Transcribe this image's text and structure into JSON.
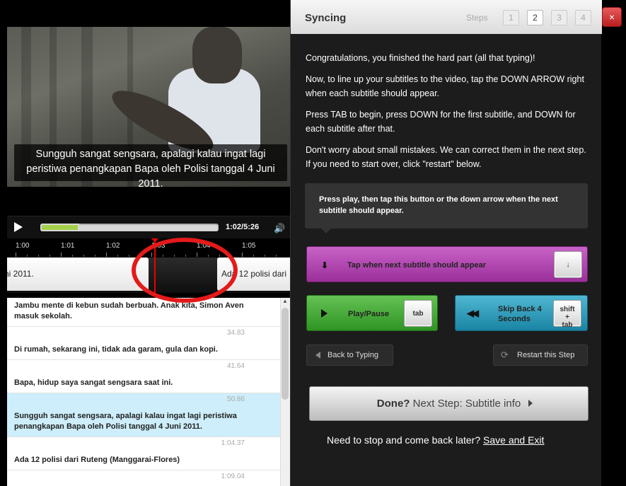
{
  "video": {
    "subtitle": "Sungguh sangat sengsara, apalagi kalau ingat lagi peristiwa penangkapan Bapa oleh Polisi tanggal 4 Juni 2011.",
    "time": "1:02/5:26",
    "progress": 0.22,
    "timeline_ticks": [
      "1:00",
      "1:01",
      "1:02",
      "1:03",
      "1:04",
      "1:05"
    ],
    "track_blocks": [
      {
        "text": "ni 2011."
      },
      {
        "text": "Ada 12 polisi dari"
      }
    ]
  },
  "subtitles": [
    {
      "time": "",
      "text": "Jambu mente di kebun sudah berbuah. Anak kita, Simon Aven masuk sekolah.",
      "active": false
    },
    {
      "time": "34.83",
      "text": "Di rumah, sekarang ini, tidak ada garam, gula dan kopi.",
      "active": false
    },
    {
      "time": "41.64",
      "text": "Bapa, hidup saya sangat sengsara saat ini.",
      "active": false
    },
    {
      "time": "50.86",
      "text": "Sungguh sangat sengsara, apalagi kalau ingat lagi peristiwa penangkapan Bapa oleh Polisi tanggal 4 Juni 2011.",
      "active": true
    },
    {
      "time": "1:04.37",
      "text": "Ada 12 polisi dari Ruteng (Manggarai-Flores)",
      "active": false
    },
    {
      "time": "1:09.04",
      "text": "",
      "active": false
    }
  ],
  "panel": {
    "title": "Syncing",
    "steps_label": "Steps",
    "steps": [
      "1",
      "2",
      "3",
      "4"
    ],
    "current_step": "2",
    "instructions": [
      "Congratulations, you finished the hard part (all that typing)!",
      "Now, to line up your subtitles to the video, tap the DOWN ARROW right when each subtitle should appear.",
      "Press TAB to begin, press DOWN for the first subtitle, and DOWN for each subtitle after that.",
      "Don't worry about small mistakes. We can correct them in the next step. If you need to start over, click \"restart\" below."
    ],
    "hint": "Press play, then tap this button or the down arrow when the next subtitle should appear.",
    "tap_button": {
      "label": "Tap when next subtitle should appear",
      "key": "↓"
    },
    "play_pause": {
      "label": "Play/Pause",
      "key": "tab"
    },
    "skip_back": {
      "label_line1": "Skip Back 4",
      "label_line2": "Seconds",
      "key_line1": "shift",
      "key_line2": "+",
      "key_line3": "tab"
    },
    "back_button": "Back to Typing",
    "restart_button": "Restart this Step",
    "done": {
      "bold": "Done?",
      "rest": " Next Step: Subtitle info"
    },
    "stop_text": "Need to stop and come back later?",
    "save_exit": "Save and Exit",
    "close": "×"
  },
  "colors": {
    "tap_button": "#b045ae",
    "play_pause": "#4caa3c",
    "skip_back": "#2c9bbd",
    "progress_fill": "#a4d14b",
    "active_row": "#cdeefa",
    "annotation_circle": "#e41a1a"
  }
}
